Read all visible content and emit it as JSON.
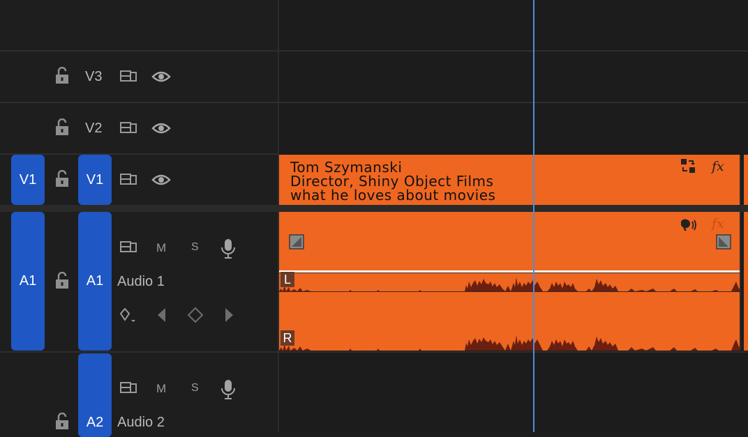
{
  "tracks": {
    "v3": {
      "name": "V3"
    },
    "v2": {
      "name": "V2"
    },
    "v1": {
      "source": "V1",
      "name": "V1"
    },
    "a1": {
      "source": "A1",
      "name": "A1",
      "label": "Audio 1",
      "mute": "M",
      "solo": "S"
    },
    "a2": {
      "name": "A2",
      "label": "Audio 2",
      "mute": "M",
      "solo": "S"
    }
  },
  "clips": {
    "video": {
      "lines": [
        "Tom Szymanski",
        "Director, Shiny Object Films",
        "what he loves about movies"
      ],
      "fx_label": "fx"
    },
    "audio": {
      "fx_label": "fx",
      "left_channel": "L",
      "right_channel": "R"
    }
  },
  "colors": {
    "clip": "#ef6620",
    "track_target": "#1f57c4",
    "playhead": "#4a8fe0",
    "background": "#1d1d1d"
  },
  "icons": [
    "lock-open-icon",
    "sync-lock-icon",
    "eye-icon",
    "microphone-icon",
    "keyframe-icon",
    "replace-icon",
    "speaker-icon"
  ]
}
